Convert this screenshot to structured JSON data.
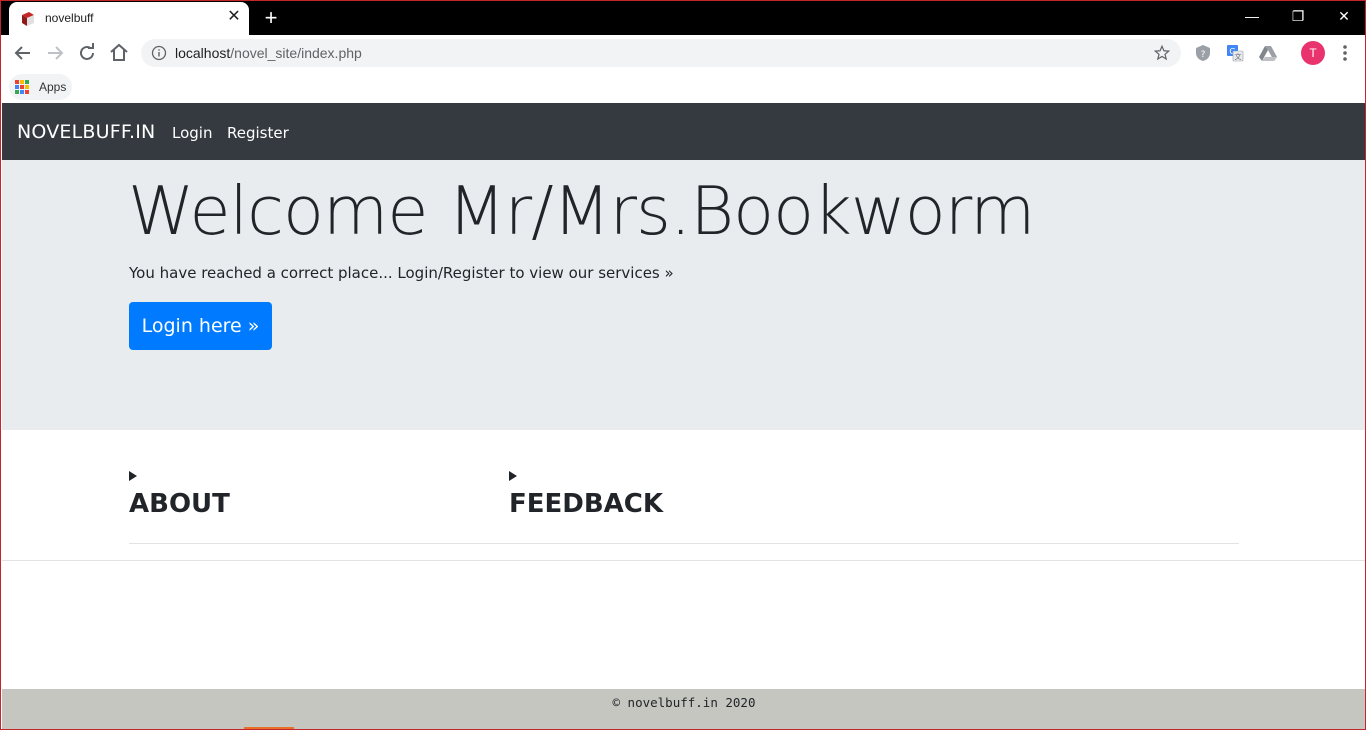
{
  "browser": {
    "tab_title": "novelbuff",
    "new_tab": "+",
    "url_host": "localhost",
    "url_path": "/novel_site/index.php",
    "avatar_letter": "T",
    "bookmarks": {
      "apps_label": "Apps"
    },
    "window_controls": {
      "minimize": "—",
      "restore": "❐",
      "close": "✕"
    }
  },
  "page": {
    "navbar": {
      "brand": "NOVELBUFF.IN",
      "links": [
        "Login",
        "Register"
      ]
    },
    "jumbotron": {
      "heading": "Welcome Mr/Mrs.Bookworm",
      "lead": "You have reached a correct place... Login/Register to view our services »",
      "button": "Login here »"
    },
    "sections": [
      {
        "title": "ABOUT"
      },
      {
        "title": "FEEDBACK"
      }
    ],
    "footer": {
      "text": "© novelbuff.in 2020"
    }
  },
  "colors": {
    "navbar_bg": "#343a40",
    "jumbotron_bg": "#e9ecef",
    "primary": "#007bff",
    "footer_bg": "#c6c6c1",
    "avatar": "#e8336e"
  },
  "icons": [
    "book-favicon-icon",
    "close-icon",
    "back-arrow-icon",
    "forward-arrow-icon",
    "reload-icon",
    "home-icon",
    "info-icon",
    "star-icon",
    "shield-extension-icon",
    "translate-icon",
    "drive-icon",
    "more-menu-icon",
    "apps-grid-icon",
    "disclosure-triangle-icon"
  ]
}
